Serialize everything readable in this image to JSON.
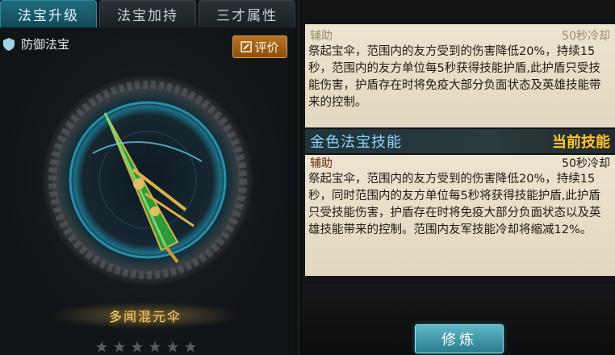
{
  "tabs": [
    {
      "label": "法宝升级",
      "active": true
    },
    {
      "label": "法宝加持",
      "active": false
    },
    {
      "label": "三才属性",
      "active": false
    }
  ],
  "left_panel": {
    "category_icon": "shield-icon",
    "category_label": "防御法宝",
    "evaluate_label": "评价",
    "evaluate_icon": "pencil-icon",
    "treasure_name": "多闻混元伞",
    "star_icon": "star-icon"
  },
  "skills": {
    "previous": {
      "type": "辅助",
      "cooldown": "50秒冷却",
      "description": "祭起宝伞，范围内的友方受到的伤害降低20%，持续15秒，范围内的友方单位每5秒获得技能护盾,此护盾只受技能伤害，护盾存在时将免疫大部分负面状态及英雄技能带来的控制。"
    },
    "gold_skill_title": "金色法宝技能",
    "current_label": "当前技能",
    "current": {
      "type": "辅助",
      "cooldown": "50秒冷却",
      "description": "祭起宝伞，范围内的友方受到的伤害降低20%，持续15秒，同时范围内的友方单位每5秒将获得技能护盾,此护盾只受技能伤害，护盾存在时将免疫大部分负面状态以及英雄技能带来的控制。范围内友军技能冷却将缩减12%。"
    }
  },
  "train_button_label": "修炼",
  "colors": {
    "active_tab": "#1f6a7c",
    "gold_text": "#ffc433",
    "skill_title": "#8fd6ff",
    "name_gold": "#ffd87a",
    "train_button": "#2a7c8c"
  }
}
